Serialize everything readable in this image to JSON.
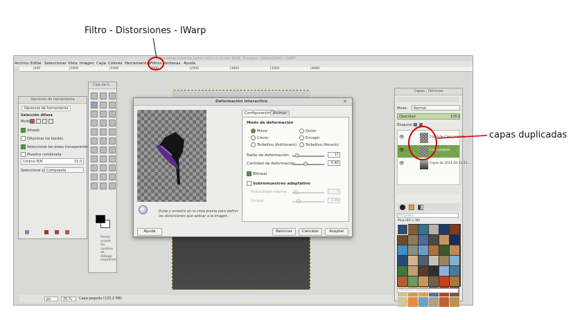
{
  "annotations": {
    "top_caption": "Filtro - Distorsiones - IWarp",
    "right_caption": "capas duplicadas"
  },
  "window": {
    "title": "*[desvanecimiento nohur.xcf-1.0 (Color RGB, 3 capas) 1920x2560 – GIMP"
  },
  "menubar": [
    "Archivo",
    "Editar",
    "Seleccionar",
    "Vista",
    "Imagen",
    "Capa",
    "Colores",
    "Herramientas",
    "Filtros",
    "Ventanas",
    "Ayuda"
  ],
  "ruler_marks": [
    "|500",
    "|1000",
    "|1500",
    "|2000",
    "|2500",
    "|3000",
    "|3500",
    "|4000"
  ],
  "tool_options": {
    "title": "Opciones de herramienta",
    "tab": "Opciones de herramienta",
    "section": "Selección difusa",
    "mode_label": "Modo:",
    "options": [
      "Alisado",
      "Difuminar los bordes",
      "Seleccionar las áreas transparentes",
      "Muestra combinada"
    ],
    "threshold_label": "Umbral B/N",
    "threshold_value": "15.0",
    "select_by_label": "Seleccionar por",
    "select_by_value": "Compuesta"
  },
  "toolbox": {
    "title": "Caja de h...",
    "hint": [
      "Puede",
      "arrastr",
      "los",
      "cuadros",
      "de",
      "diálogo",
      "empotrad"
    ]
  },
  "dialog": {
    "title": "Deformación interactiva",
    "tabs": [
      "Configuración",
      "Animar"
    ],
    "mode_heading": "Modo de deformación",
    "modes": [
      "Mover",
      "Quitar",
      "Crecer",
      "Encoger",
      "Torbellino (Antihorario)",
      "Torbellino (Horario)"
    ],
    "radius_label": "Radio de deformación:",
    "radius_value": "17",
    "amount_label": "Cantidad de deformación:",
    "amount_value": "0.40",
    "bilinear_label": "Bilineal",
    "adaptive_label": "Sobremuestreo adaptativo",
    "max_depth_label": "Profundidad máxima",
    "max_depth_value": "3",
    "threshold_label": "Umbral",
    "threshold_value": "2.00",
    "hint_text": [
      "Pulse y arrastre en la vista previa para definir",
      "las distorsiones que aplicar a la imagen."
    ],
    "buttons": {
      "help": "Ayuda",
      "reset": "Reiniciar",
      "cancel": "Cancelar",
      "ok": "Aceptar"
    }
  },
  "layers": {
    "title": "Capas - Patrones",
    "mode_label": "Modo:",
    "mode_value": "Normal",
    "opacity_label": "Opacidad",
    "opacity_value": "100.0",
    "lock_label": "Bloquear:",
    "items": [
      {
        "name": "Copia de Capa pegada"
      },
      {
        "name": "Capa pegada"
      },
      {
        "name": "Copia de 2014-04-11 21..."
      }
    ],
    "filter_placeholder": "Etiqueta",
    "pattern_name": "Pine (64 × 36)",
    "tag_placeholder": "Introducir etiquetas",
    "pattern_colors": [
      "#2d4f6e",
      "#7e5d3c",
      "#3c6f8f",
      "#b9b2a6",
      "#1e3c66",
      "#7c3d1c",
      "#6b4d2a",
      "#8c7a58",
      "#4f6b9a",
      "#4a4a4a",
      "#c29460",
      "#1a2c5a",
      "#3f8fc2",
      "#8e8e7e",
      "#6e9cc8",
      "#b07040",
      "#3a5a2a",
      "#bf8a52",
      "#2a4a7a",
      "#d2b48c",
      "#506070",
      "#c8c0b0",
      "#a08060",
      "#7fb0d8",
      "#3a7a3a",
      "#c0a070",
      "#5a3a2a",
      "#2e2e2e",
      "#8ab4e0",
      "#4a7a9a",
      "#b06030",
      "#6a9a5a",
      "#c89a5a",
      "#7a6040",
      "#c84020",
      "#a8783a",
      "#d4c090",
      "#d0a040",
      "#e8a030",
      "#5070a0",
      "#c04010",
      "#6a5a4a",
      "#d0c8a0",
      "#e09040",
      "#70a0c0",
      "#b0a080",
      "#c06030",
      "#c09050"
    ]
  },
  "statusbar": {
    "unit": "px",
    "zoom": "25 %",
    "layer_info": "Capa pegada (133.2 MB)"
  }
}
